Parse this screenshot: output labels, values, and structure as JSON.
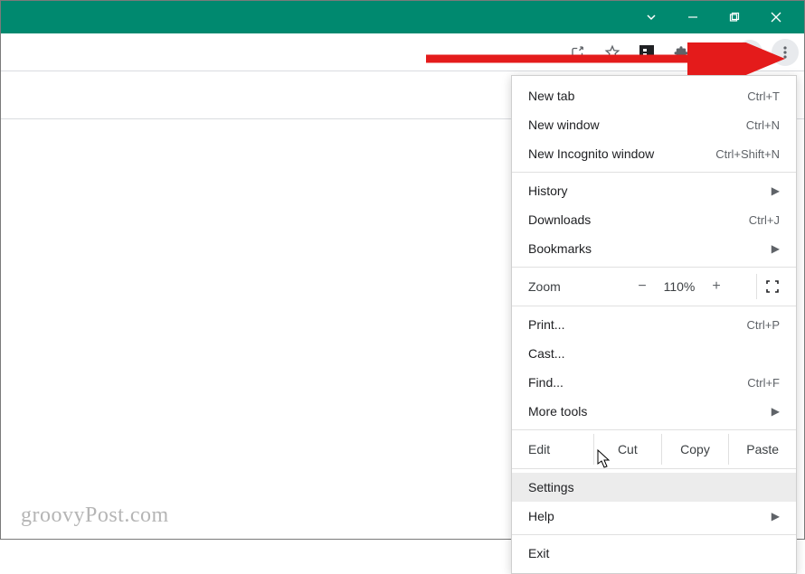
{
  "window": {
    "titlebar_color": "#00896f"
  },
  "menu": {
    "new_tab": {
      "label": "New tab",
      "shortcut": "Ctrl+T"
    },
    "new_window": {
      "label": "New window",
      "shortcut": "Ctrl+N"
    },
    "new_incognito": {
      "label": "New Incognito window",
      "shortcut": "Ctrl+Shift+N"
    },
    "history": {
      "label": "History"
    },
    "downloads": {
      "label": "Downloads",
      "shortcut": "Ctrl+J"
    },
    "bookmarks": {
      "label": "Bookmarks"
    },
    "zoom": {
      "label": "Zoom",
      "value": "110%",
      "minus": "−",
      "plus": "+"
    },
    "print": {
      "label": "Print...",
      "shortcut": "Ctrl+P"
    },
    "cast": {
      "label": "Cast..."
    },
    "find": {
      "label": "Find...",
      "shortcut": "Ctrl+F"
    },
    "more_tools": {
      "label": "More tools"
    },
    "edit": {
      "label": "Edit",
      "cut": "Cut",
      "copy": "Copy",
      "paste": "Paste"
    },
    "settings": {
      "label": "Settings"
    },
    "help": {
      "label": "Help"
    },
    "exit": {
      "label": "Exit"
    }
  },
  "watermark": "groovyPost.com"
}
